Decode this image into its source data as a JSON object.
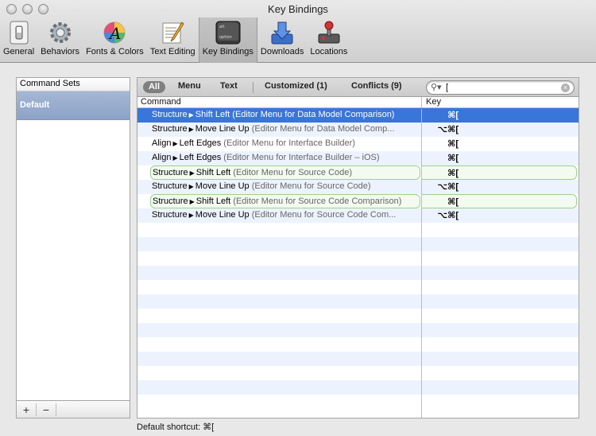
{
  "window": {
    "title": "Key Bindings"
  },
  "toolbar": {
    "items": [
      {
        "label": "General",
        "icon": "general-switch-icon"
      },
      {
        "label": "Behaviors",
        "icon": "gears-icon"
      },
      {
        "label": "Fonts & Colors",
        "icon": "fonts-colors-icon"
      },
      {
        "label": "Text Editing",
        "icon": "text-editing-icon"
      },
      {
        "label": "Key Bindings",
        "icon": "keyboard-key-icon",
        "key_top": "alt",
        "key_bottom": "option"
      },
      {
        "label": "Downloads",
        "icon": "downloads-icon"
      },
      {
        "label": "Locations",
        "icon": "joystick-icon"
      }
    ],
    "active": "Key Bindings"
  },
  "command_sets": {
    "header": "Command Sets",
    "items": [
      "Default"
    ],
    "add_label": "+",
    "remove_label": "−"
  },
  "scope_bar": {
    "all": "All",
    "menu": "Menu",
    "text": "Text",
    "customized": "Customized (1)",
    "conflicts": "Conflicts (9)"
  },
  "search": {
    "value": "["
  },
  "table": {
    "columns": [
      "Command",
      "Key"
    ],
    "rows": [
      {
        "group": "Structure",
        "command": "Shift Left",
        "context": "(Editor Menu for Data Model Comparison)",
        "key": "⌘[",
        "selected": true,
        "highlight": false
      },
      {
        "group": "Structure",
        "command": "Move Line Up",
        "context": "(Editor Menu for Data Model Comp...",
        "key": "⌥⌘[",
        "selected": false,
        "highlight": false
      },
      {
        "group": "Align",
        "command": "Left Edges",
        "context": "(Editor Menu for Interface Builder)",
        "key": "⌘[",
        "selected": false,
        "highlight": false
      },
      {
        "group": "Align",
        "command": "Left Edges",
        "context": "(Editor Menu for Interface Builder – iOS)",
        "key": "⌘[",
        "selected": false,
        "highlight": false
      },
      {
        "group": "Structure",
        "command": "Shift Left",
        "context": "(Editor Menu for Source Code)",
        "key": "⌘[",
        "selected": false,
        "highlight": true
      },
      {
        "group": "Structure",
        "command": "Move Line Up",
        "context": "(Editor Menu for Source Code)",
        "key": "⌥⌘[",
        "selected": false,
        "highlight": false
      },
      {
        "group": "Structure",
        "command": "Shift Left",
        "context": "(Editor Menu for Source Code Comparison)",
        "key": "⌘[",
        "selected": false,
        "highlight": true
      },
      {
        "group": "Structure",
        "command": "Move Line Up",
        "context": "(Editor Menu for Source Code Com...",
        "key": "⌥⌘[",
        "selected": false,
        "highlight": false
      }
    ]
  },
  "status": {
    "text": "Default shortcut: ⌘["
  }
}
